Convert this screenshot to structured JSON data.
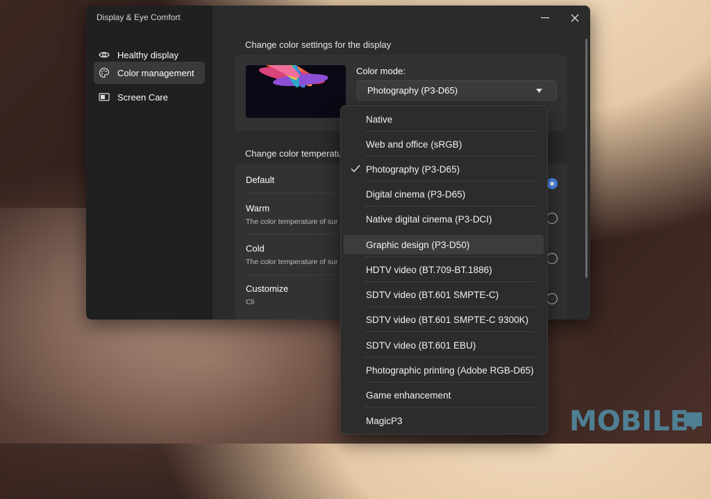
{
  "app": {
    "title": "Display & Eye Comfort"
  },
  "sidebar": {
    "items": [
      {
        "label": "Healthy display",
        "icon": "eye-icon"
      },
      {
        "label": "Color management",
        "icon": "palette-icon",
        "active": true
      },
      {
        "label": "Screen Care",
        "icon": "screen-care-icon"
      }
    ]
  },
  "main": {
    "color_settings_title": "Change color settings for the display",
    "color_mode_label": "Color mode:",
    "color_mode_value": "Photography (P3-D65)",
    "temperature_title": "Change color temperatu",
    "temperature_options": [
      {
        "title": "Default",
        "desc": "",
        "selected": true
      },
      {
        "title": "Warm",
        "desc": "The color temperature of sur",
        "selected": false
      },
      {
        "title": "Cold",
        "desc": "The color temperature of sur",
        "selected": false
      },
      {
        "title": "Customize",
        "desc": "Cli",
        "selected": false
      }
    ]
  },
  "dropdown": {
    "options": [
      "Native",
      "Web and office (sRGB)",
      "Photography (P3-D65)",
      "Digital cinema (P3-D65)",
      "Native digital cinema (P3-DCI)",
      "Graphic design (P3-D50)",
      "HDTV video (BT.709-BT.1886)",
      "SDTV video (BT.601 SMPTE-C)",
      "SDTV video (BT.601 SMPTE-C 9300K)",
      "SDTV video (BT.601 EBU)",
      "Photographic printing (Adobe RGB-D65)",
      "Game enhancement",
      "MagicP3"
    ],
    "checked_index": 2,
    "hover_index": 5
  },
  "watermark": {
    "text": "MOBILE"
  },
  "colors": {
    "accent": "#4c8df6",
    "window_bg": "#2b2b2b",
    "sidebar_bg": "#202020"
  }
}
